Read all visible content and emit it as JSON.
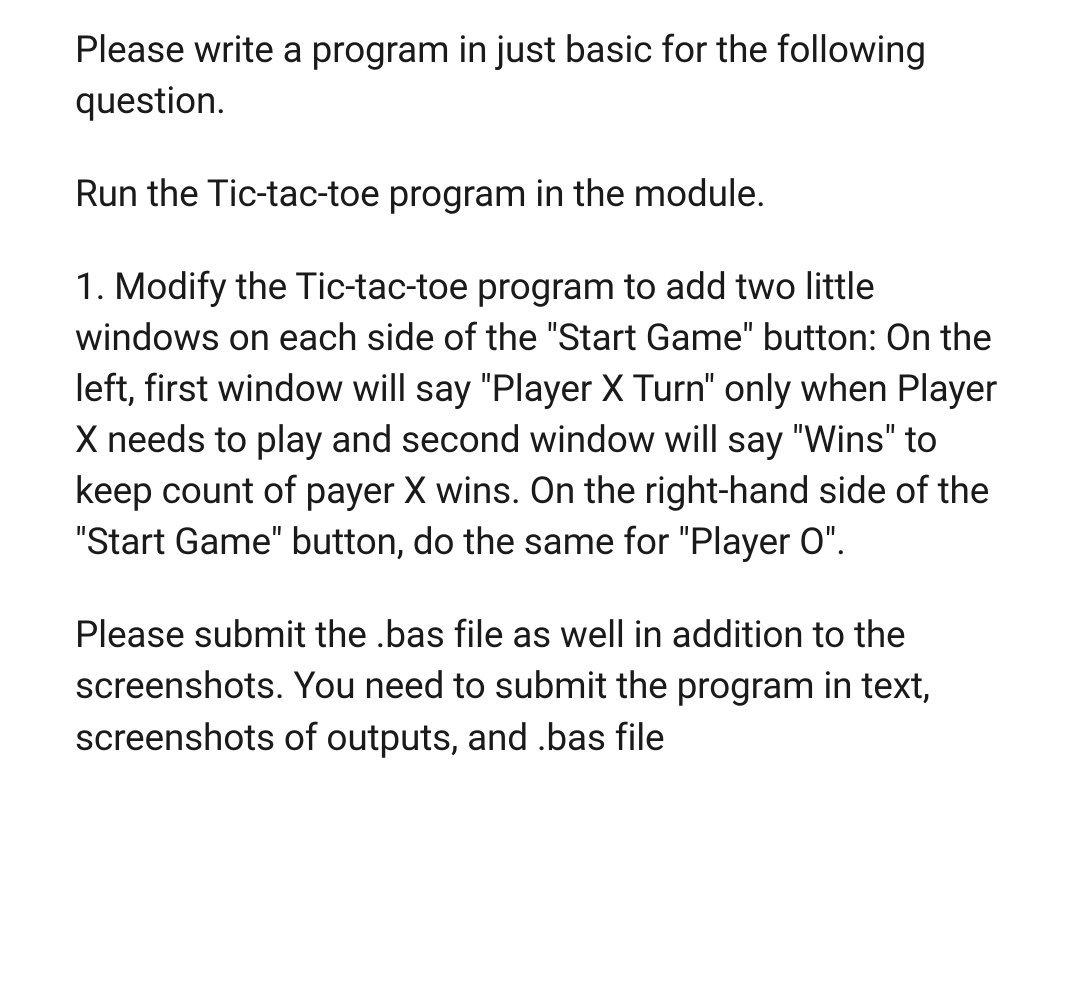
{
  "paragraphs": [
    "Please write a program in just basic for the following question.",
    "Run the Tic-tac-toe program in the module.",
    "1. Modify the Tic-tac-toe program to add two little windows on each side of the \"Start Game\" button: On the left, first window will say \"Player X Turn\" only when Player X needs to play and second window will say \"Wins\" to keep count of payer X wins. On the right-hand side of the \"Start Game\" button, do the same for \"Player O\".",
    "Please submit the .bas file as well in addition to the screenshots. You need to submit the program in text, screenshots of outputs, and .bas file"
  ]
}
